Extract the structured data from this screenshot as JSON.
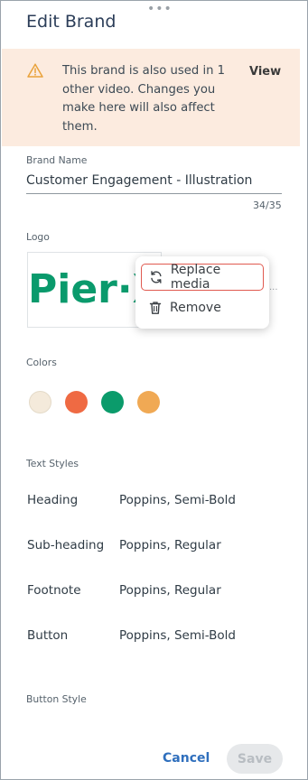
{
  "header": {
    "title": "Edit Brand",
    "drag_handle": "•••"
  },
  "warning": {
    "message": "This brand is also used in 1 other video. Changes you make here will also affect them.",
    "action_label": "View",
    "icon": "warning-triangle-icon",
    "background": "#fcebdf",
    "icon_color": "#e9a23b"
  },
  "brand_name": {
    "label": "Brand Name",
    "value": "Customer Engagement - Illustration",
    "counter": "34/35"
  },
  "logo": {
    "label": "Logo",
    "logo_text": "Pier·X",
    "logo_color": "#0a9a6c",
    "more_label": "...",
    "menu": {
      "items": [
        {
          "label": "Replace media",
          "icon": "refresh-icon"
        },
        {
          "label": "Remove",
          "icon": "trash-icon"
        }
      ],
      "highlight_color": "#e05a50"
    }
  },
  "colors": {
    "label": "Colors",
    "swatches": [
      "#f4eadb",
      "#ef6a43",
      "#0b9b6b",
      "#f0a954"
    ]
  },
  "text_styles": {
    "label": "Text Styles",
    "rows": [
      {
        "name": "Heading",
        "value": "Poppins, Semi-Bold"
      },
      {
        "name": "Sub-heading",
        "value": "Poppins, Regular"
      },
      {
        "name": "Footnote",
        "value": "Poppins, Regular"
      },
      {
        "name": "Button",
        "value": "Poppins, Semi-Bold"
      }
    ]
  },
  "button_style": {
    "label": "Button Style"
  },
  "footer": {
    "cancel_label": "Cancel",
    "save_label": "Save",
    "accent_color": "#2f6fbd"
  }
}
